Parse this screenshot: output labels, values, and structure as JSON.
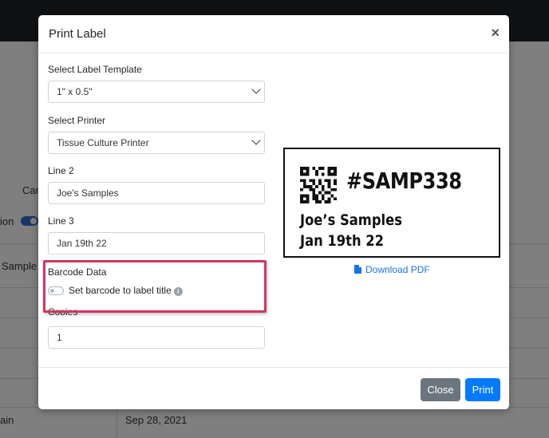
{
  "background": {
    "texts": {
      "car": "Car",
      "option": "ion",
      "sample": "Sample",
      "strain": "ain",
      "date": "Sep 28, 2021"
    }
  },
  "modal": {
    "title": "Print Label",
    "close_icon": "×",
    "fields": {
      "template_label": "Select Label Template",
      "template_value": "1\" x 0.5\"",
      "printer_label": "Select Printer",
      "printer_value": "Tissue Culture Printer",
      "line2_label": "Line 2",
      "line2_value": "Joe's Samples",
      "line3_label": "Line 3",
      "line3_value": "Jan 19th 22",
      "barcode_label": "Barcode Data",
      "barcode_toggle_label": "Set barcode to label title",
      "barcode_toggle_on": false,
      "copies_label": "Copies",
      "copies_value": "1"
    },
    "preview": {
      "title": "#SAMP338",
      "line2": "Joe’s Samples",
      "line3": "Jan 19th 22",
      "download_label": "Download PDF"
    },
    "footer": {
      "close_label": "Close",
      "print_label": "Print"
    }
  },
  "colors": {
    "primary": "#007bff",
    "secondary": "#6c757d",
    "highlight": "#d2365f",
    "link": "#1a73e8"
  },
  "icons": {
    "close": "close-icon",
    "info": "info-icon",
    "pdf": "file-pdf-icon",
    "chevron": "chevron-down-icon",
    "qr": "qr-code-icon"
  }
}
